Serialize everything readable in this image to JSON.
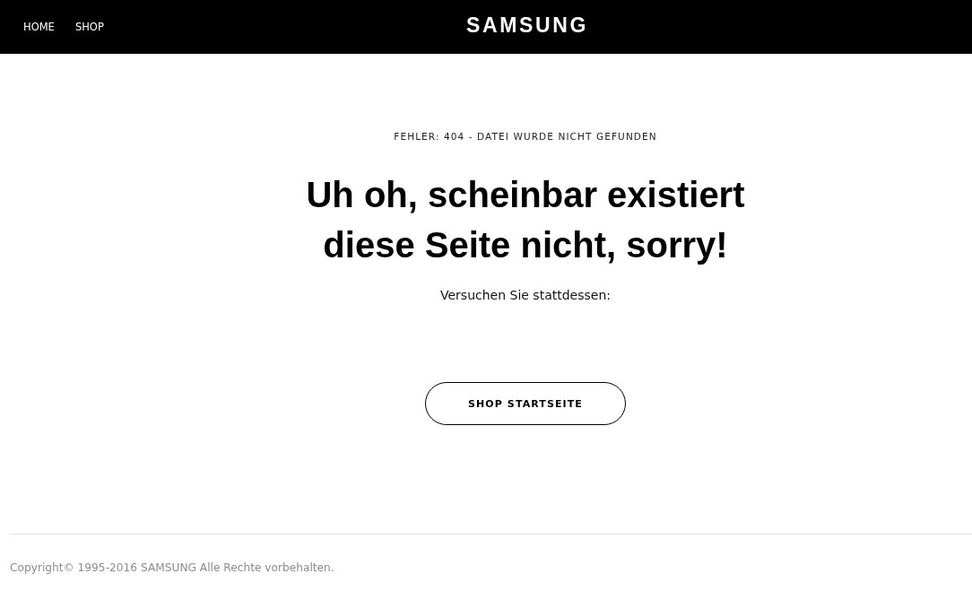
{
  "header": {
    "nav": [
      {
        "label": "HOME"
      },
      {
        "label": "SHOP"
      }
    ],
    "logo": "SAMSUNG"
  },
  "main": {
    "error_label": "FEHLER: 404 - DATEI WURDE NICHT GEFUNDEN",
    "heading_lines": [
      "Uh oh, scheinbar existiert",
      "diese Seite nicht, sorry!"
    ],
    "subtext": "Versuchen Sie stattdessen:",
    "button": "SHOP STARTSEITE"
  },
  "footer": {
    "copyright": "Copyright© 1995-2016 SAMSUNG Alle Rechte vorbehalten."
  }
}
